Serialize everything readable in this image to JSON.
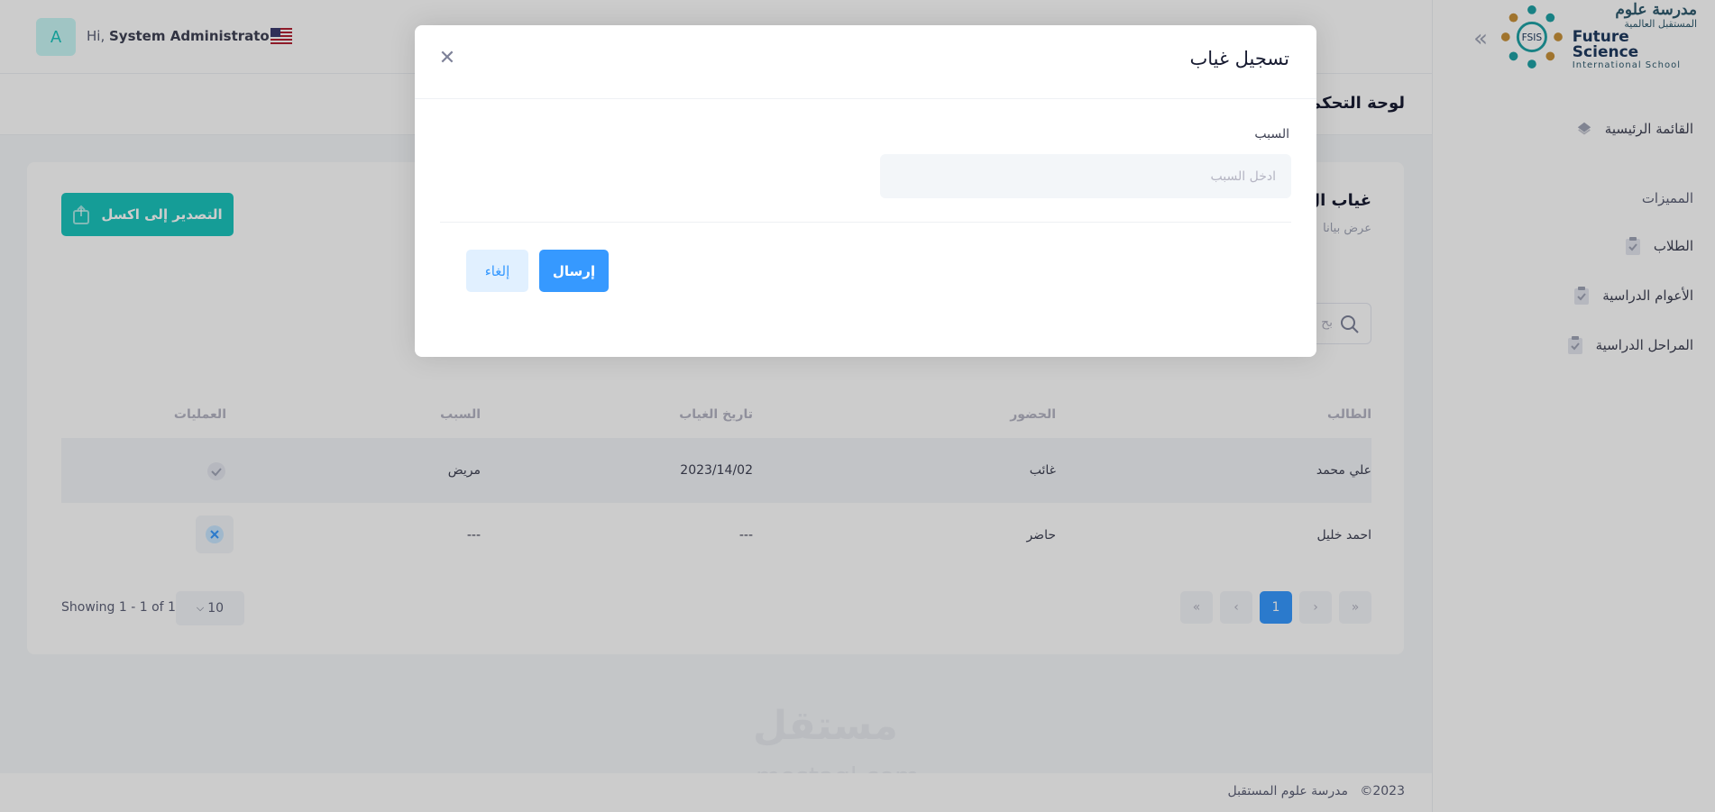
{
  "sidebar": {
    "logo": {
      "ar_name": "مدرسة علوم",
      "ar_sub": "المستقبل العالمية",
      "en_name": "Future Science",
      "en_sub": "International School",
      "mark_text": "FSIS"
    },
    "main_menu": "القائمة الرئيسية",
    "section": "المميزات",
    "items": [
      {
        "label": "الطلاب",
        "icon": "clipboard-icon"
      },
      {
        "label": "الأعوام الدراسية",
        "icon": "clipboard-icon"
      },
      {
        "label": "المراحل الدراسية",
        "icon": "clipboard-icon"
      }
    ]
  },
  "header": {
    "avatar_letter": "A",
    "greeting": "Hi,",
    "user_name": "System Administrator"
  },
  "subheader": {
    "title": "لوحة التحكم"
  },
  "card": {
    "title": "غياب ال",
    "subtitle": "عرض بيانا",
    "export_label": "التصدير إلى اكسل",
    "search_placeholder": "بح"
  },
  "table": {
    "columns": [
      "الطالب",
      "الحضور",
      "تاريخ الغياب",
      "السبب",
      "العمليات"
    ],
    "rows": [
      {
        "student": "علي محمد",
        "attendance": "غائب",
        "date": "2023/14/02",
        "reason": "مريض",
        "action": "check"
      },
      {
        "student": "احمد خليل",
        "attendance": "حاضر",
        "date": "---",
        "reason": "---",
        "action": "close"
      }
    ]
  },
  "pagination": {
    "current": "1",
    "per_page": "10",
    "showing": "Showing 1 - 1 of 1"
  },
  "footer": {
    "year": "2023©",
    "name": "مدرسة علوم المستقبل"
  },
  "watermark": {
    "line1": "مستقل",
    "line2": "mostaql.com"
  },
  "modal": {
    "title": "تسجيل غياب",
    "field_label": "السبب",
    "field_placeholder": "ادخل السبب",
    "submit_label": "إرسال",
    "cancel_label": "إلغاء"
  },
  "colors": {
    "primary": "#3699ff",
    "success": "#1bc5bd",
    "avatar_bg": "#c9f7f5"
  }
}
